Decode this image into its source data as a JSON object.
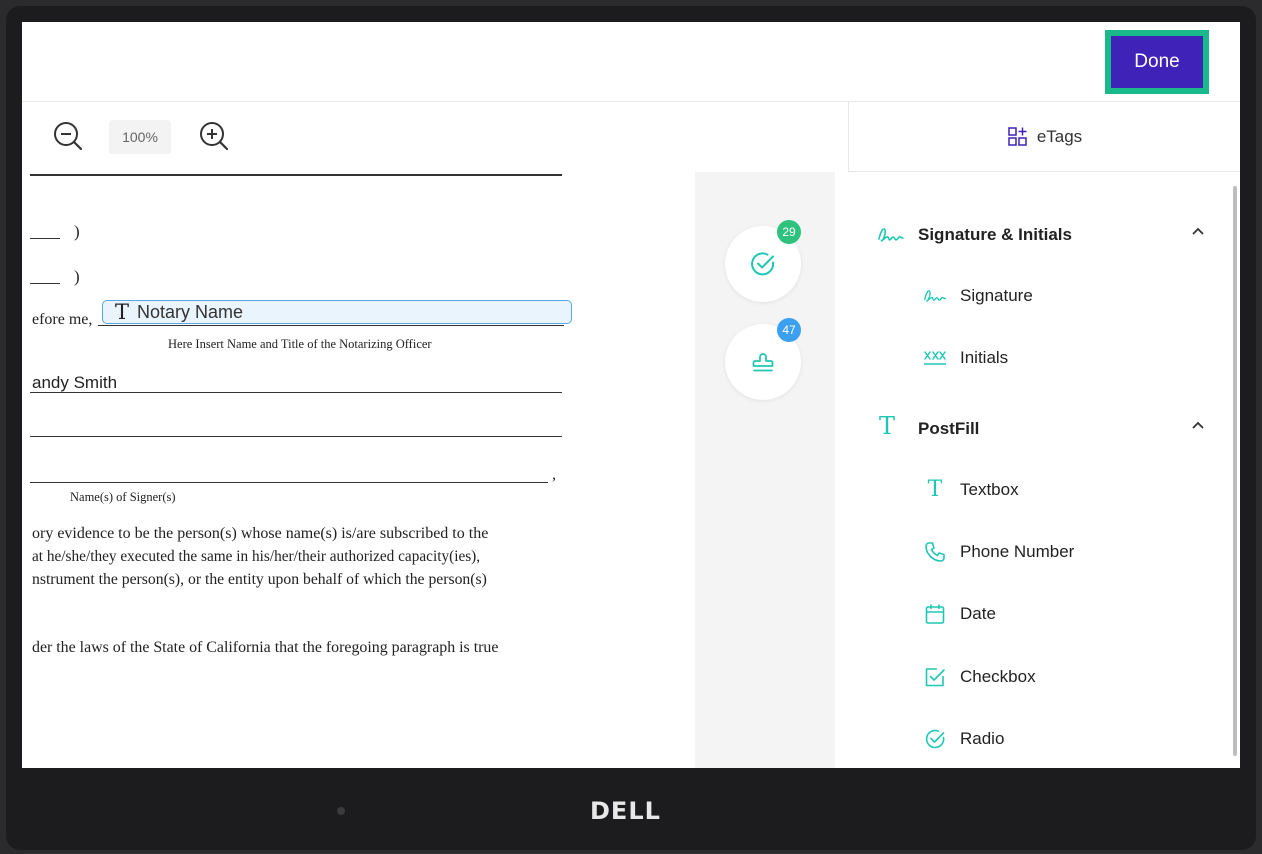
{
  "topbar": {
    "done_label": "Done"
  },
  "toolbar": {
    "zoom_level": "100%"
  },
  "etags": {
    "title": "eTags"
  },
  "document": {
    "paren_1": ")",
    "paren_2": ")",
    "before_me": "efore me,",
    "notary_field_label": "Notary Name",
    "notary_caption": "Here Insert Name and Title of the Notarizing Officer",
    "signer_name": "andy Smith",
    "comma": ",",
    "signers_caption": "Name(s) of Signer(s)",
    "para_line_1": "ory evidence to be the person(s) whose name(s) is/are subscribed to the",
    "para_line_2": "at he/she/they executed the same in his/her/their authorized capacity(ies),",
    "para_line_3": "nstrument the person(s), or the entity upon behalf of which the person(s)",
    "perjury_line": "der the laws of the State of California that the foregoing paragraph is true"
  },
  "rail": {
    "completed_badge": "29",
    "stamp_badge": "47",
    "colors": {
      "completed": "#2ec27e",
      "stamp": "#3aa0ef",
      "icon": "#20c7b4"
    }
  },
  "panel": {
    "sections": [
      {
        "label": "Signature & Initials",
        "icon": "signature-icon",
        "items": [
          {
            "label": "Signature",
            "icon": "signature-icon"
          },
          {
            "label": "Initials",
            "icon": "initials-icon"
          }
        ]
      },
      {
        "label": "PostFill",
        "icon": "text-icon",
        "items": [
          {
            "label": "Textbox",
            "icon": "text-icon"
          },
          {
            "label": "Phone Number",
            "icon": "phone-icon"
          },
          {
            "label": "Date",
            "icon": "calendar-icon"
          },
          {
            "label": "Checkbox",
            "icon": "checkbox-icon"
          },
          {
            "label": "Radio",
            "icon": "radio-check-icon"
          }
        ]
      }
    ]
  },
  "device": {
    "brand": "DELL"
  }
}
